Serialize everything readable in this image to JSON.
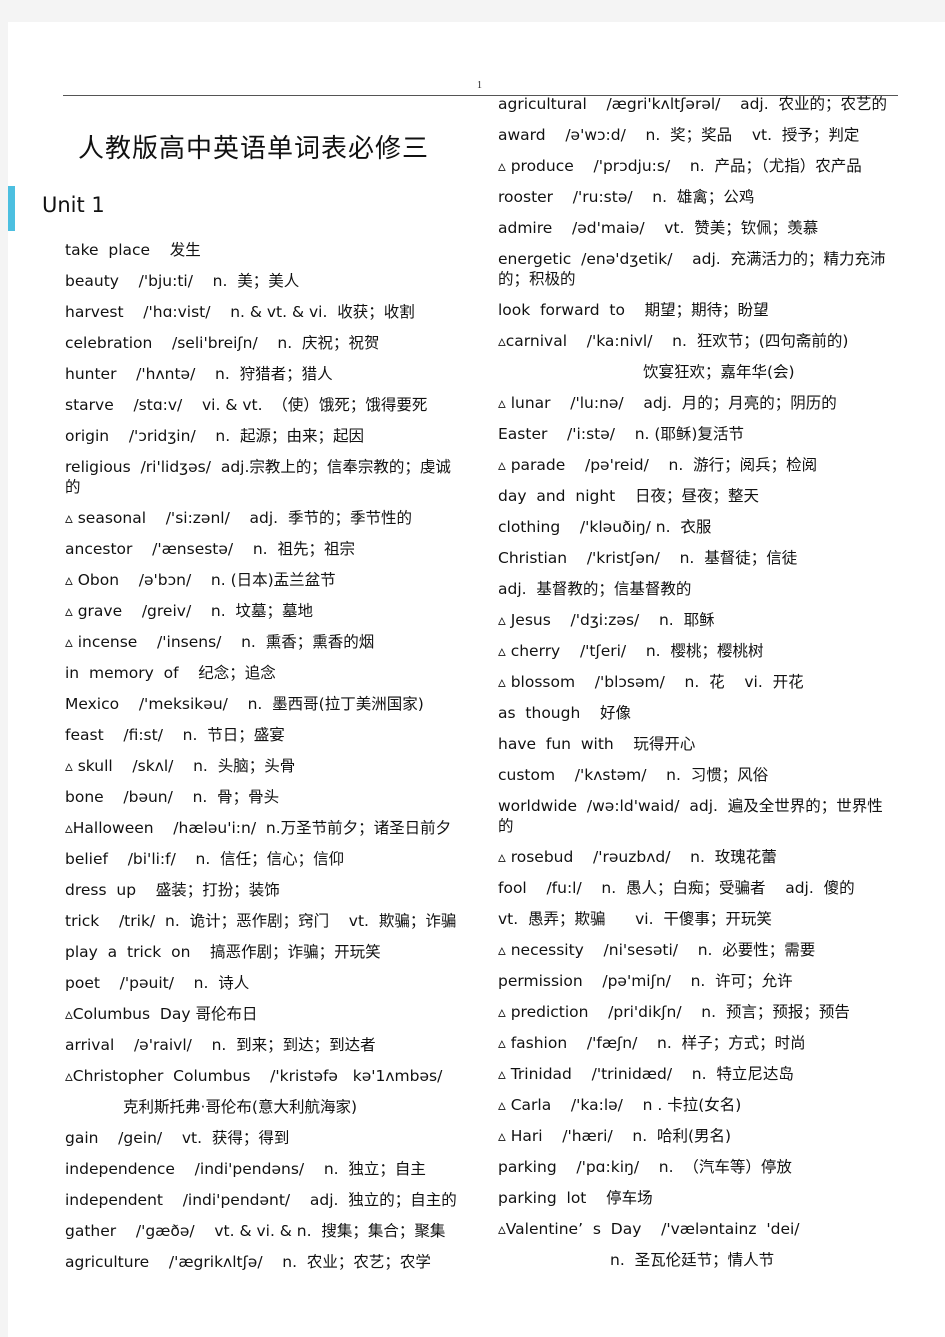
{
  "document": {
    "page_number": "1",
    "title": "人教版高中英语单词表必修三",
    "unit_heading": "Unit 1",
    "accent_color": "#4cbfe0"
  },
  "left_column": [
    "take  place    发生",
    "beauty    /'bju:ti/    n.  美；美人",
    "harvest    /'hɑ:vist/    n. & vt. & vi.  收获；收割",
    "celebration    /seli'breiʃn/    n.  庆祝；祝贺",
    "hunter    /'hʌntə/    n.  狩猎者；猎人",
    "starve    /stɑ:v/    vi. & vt.  （使）饿死；饿得要死",
    "origin    /'ɔridʒin/    n.  起源；由来；起因",
    "religious  /ri'lidʒəs/  adj.宗教上的；信奉宗教的；虔诚的",
    "▵ seasonal    /'si:zənl/    adj.  季节的；季节性的",
    "ancestor    /'ænsestə/    n.  祖先；祖宗",
    "▵ Obon    /ə'bɔn/    n. (日本)盂兰盆节",
    "▵ grave    /greiv/    n.  坟墓；墓地",
    "▵ incense    /'insens/    n.  熏香；熏香的烟",
    "in  memory  of    纪念；追念",
    "Mexico    /'meksikəu/    n.  墨西哥(拉丁美洲国家)",
    "feast    /fi:st/    n.  节日；盛宴",
    "▵ skull    /skʌl/    n.  头脑；头骨",
    "bone    /bəun/    n.  骨；骨头",
    "▵Halloween    /hæləu'i:n/  n.万圣节前夕；诸圣日前夕",
    "belief    /bi'li:f/    n.  信任；信心；信仰",
    "dress  up    盛装；打扮；装饰",
    "trick    /trik/  n.  诡计；恶作剧；窍门    vt.  欺骗；诈骗",
    "play  a  trick  on    搞恶作剧；诈骗；开玩笑",
    "poet    /'pəuit/    n.  诗人",
    "▵Columbus  Day 哥伦布日",
    "arrival    /ə'raivl/    n.  到来；到达；到达者",
    "▵Christopher  Columbus    /'kristəfə   kə'1ʌmbəs/",
    {
      "indent": 1,
      "text": "克利斯托弗·哥伦布(意大利航海家)"
    },
    "gain    /gein/    vt.  获得；得到",
    "independence    /indi'pendəns/    n.  独立；自主",
    "independent    /indi'pendənt/    adj.  独立的；自主的",
    "gather    /'gæðə/    vt. & vi. & n.  搜集；集合；聚集",
    "agriculture    /'ægrikʌltʃə/    n.  农业；农艺；农学"
  ],
  "right_column": [
    "agricultural    /ægri'kʌltʃərəl/    adj.  农业的；农艺的",
    "award    /ə'wɔ:d/    n.  奖；奖品    vt.  授予；判定",
    "▵ produce    /'prɔdju:s/    n.  产品；（尤指）农产品",
    "rooster    /'ru:stə/    n.  雄禽；公鸡",
    "admire    /əd'maiə/    vt.  赞美；钦佩；羡慕",
    "energetic  /enə'dʒetik/    adj.  充满活力的；精力充沛的；积极的",
    "look  forward  to    期望；期待；盼望",
    "▵carnival    /'ka:nivl/    n.  狂欢节；(四句斋前的)",
    {
      "indent": 2,
      "text": "饮宴狂欢；嘉年华(会)"
    },
    "▵ lunar    /'lu:nə/    adj.  月的；月亮的；阴历的",
    "Easter    /'i:stə/    n. (耶稣)复活节",
    "▵ parade    /pə'reid/    n.  游行；阅兵；检阅",
    "day  and  night    日夜；昼夜；整天",
    "clothing    /'kləuðiŋ/ n.  衣服",
    "Christian    /'kristʃən/    n.  基督徒；信徒",
    "adj.  基督教的；信基督教的",
    "▵ Jesus    /'dʒi:zəs/    n.  耶稣",
    "▵ cherry    /'tʃeri/    n.  樱桃；樱桃树",
    "▵ blossom    /'blɔsəm/    n.  花    vi.  开花",
    "as  though    好像",
    "have  fun  with    玩得开心",
    "custom    /'kʌstəm/    n.  习惯；风俗",
    "worldwide  /wə:ld'waid/  adj.  遍及全世界的；世界性的",
    "▵ rosebud    /'rəuzbʌd/    n.  玫瑰花蕾",
    "fool    /fu:l/    n.  愚人；白痴；受骗者    adj.  傻的",
    "vt.  愚弄；欺骗      vi.  干傻事；开玩笑",
    "▵ necessity    /ni'sesəti/    n.  必要性；需要",
    "permission    /pə'miʃn/    n.  许可；允许",
    "▵ prediction    /pri'dikʃn/    n.  预言；预报；预告",
    "▵ fashion    /'fæʃn/    n.  样子；方式；时尚",
    "▵ Trinidad    /'trinidæd/    n.  特立尼达岛",
    "▵ Carla    /'ka:lə/    n . 卡拉(女名)",
    "▵ Hari    /'hæri/    n.  哈利(男名)",
    "parking    /'pɑ:kiŋ/    n.  （汽车等）停放",
    "parking  lot    停车场",
    "▵Valentine’  s  Day    /'væləntainz  'dei/",
    {
      "indent": 3,
      "text": "n.  圣瓦伦廷节；情人节"
    }
  ]
}
